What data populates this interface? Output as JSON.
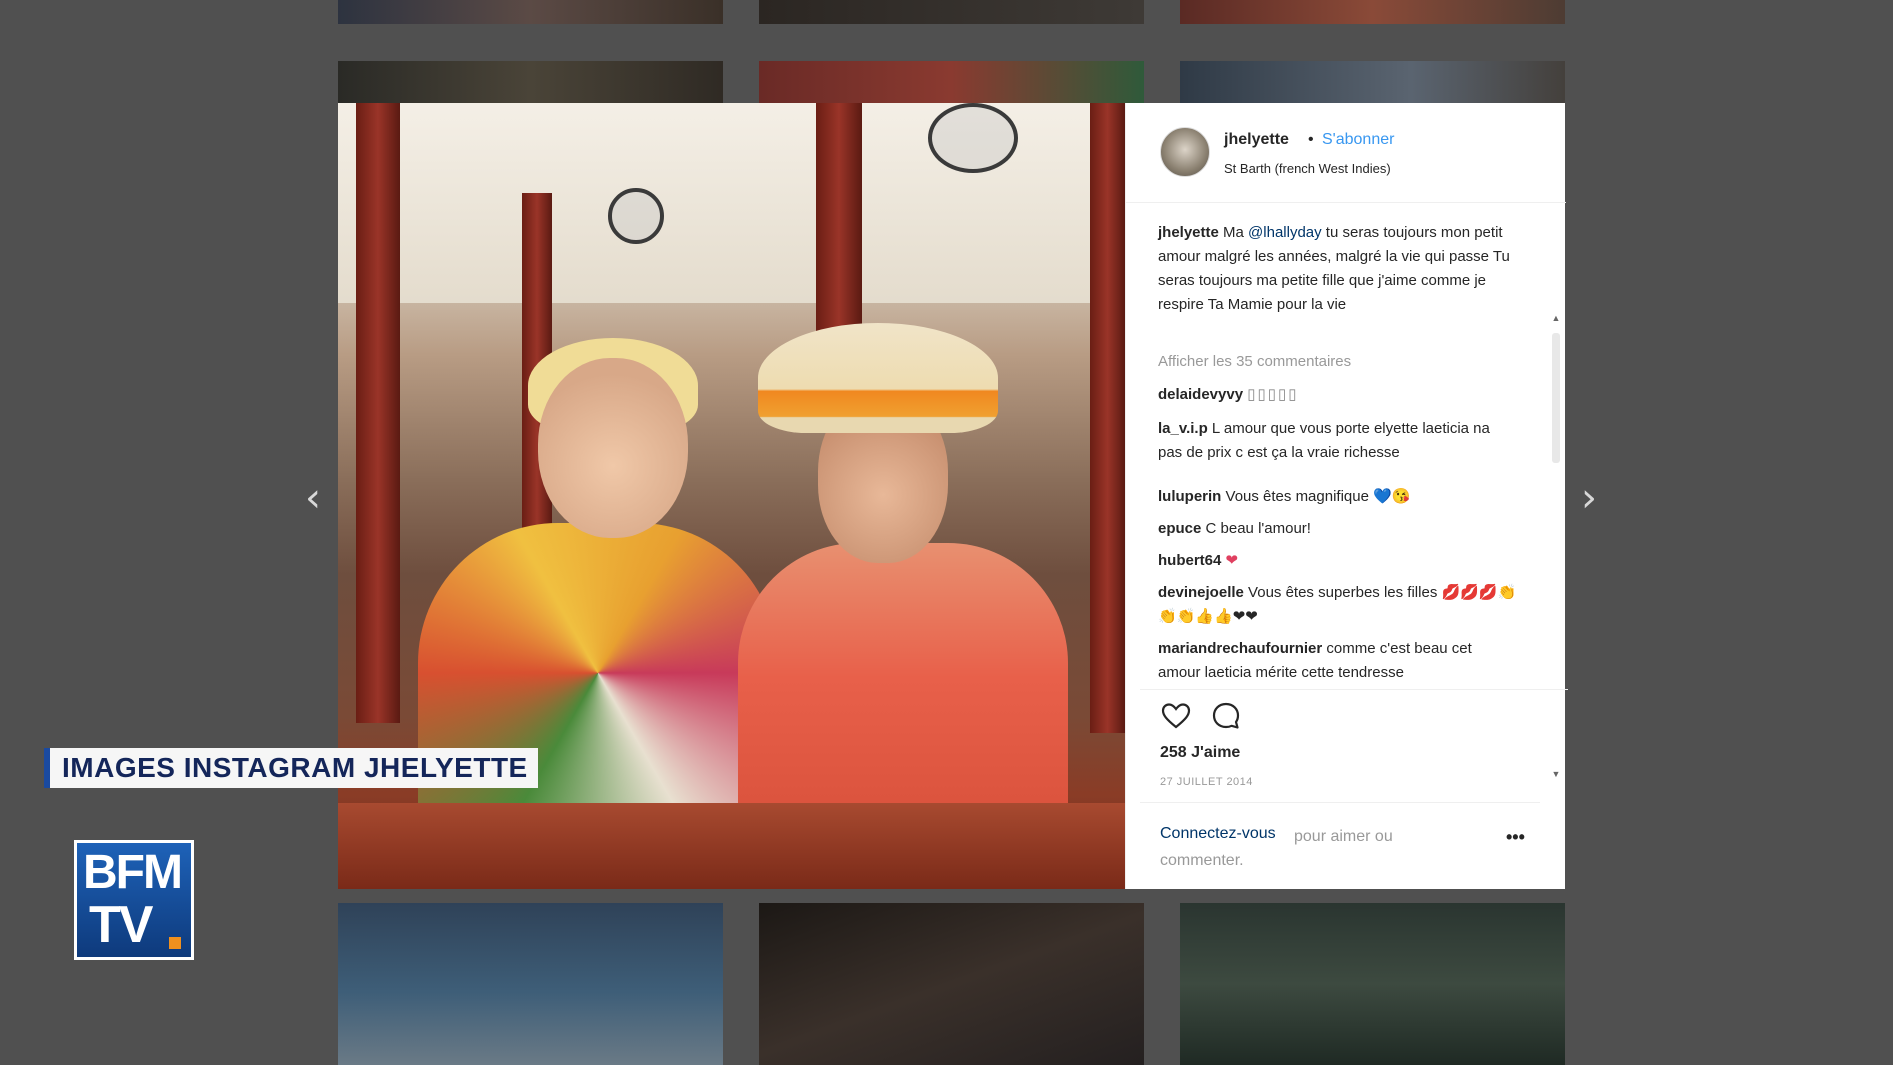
{
  "post": {
    "username": "jhelyette",
    "separator": "•",
    "follow_label": "S'abonner",
    "location": "St Barth (french West Indies)",
    "caption": {
      "user": "jhelyette",
      "text_before": "Ma ",
      "mention": "@lhallyday",
      "text_after": " tu seras toujours mon petit amour malgré les années, malgré la vie qui passe Tu seras toujours ma petite fille que j'aime comme je respire Ta Mamie pour la vie"
    },
    "view_all_comments": "Afficher les 35 commentaires",
    "comments": [
      {
        "user": "delaidevyvy",
        "text": "▯▯▯▯▯"
      },
      {
        "user": "la_v.i.p",
        "text": "L amour que vous porte elyette laeticia na pas de prix c est ça la vraie richesse"
      },
      {
        "user": "luluperin",
        "text": "Vous êtes magnifique 💙😘"
      },
      {
        "user": "epuce",
        "text": "C beau l'amour!"
      },
      {
        "user": "hubert64",
        "text": "❤"
      },
      {
        "user": "devinejoelle",
        "text": "Vous êtes superbes les filles 💋💋💋👏👏👏👍👍❤❤"
      },
      {
        "user": "mariandrechaufournier",
        "text": "comme c'est beau cet amour laeticia mérite cette tendresse"
      }
    ],
    "likes": "258 J'aime",
    "date": "27 JUILLET 2014",
    "login_link": "Connectez-vous",
    "login_rest": "pour aimer ou commenter.",
    "more_label": "•••"
  },
  "overlay": {
    "lower_third": "IMAGES INSTAGRAM JHELYETTE",
    "logo_line1": "BFM",
    "logo_line2": "TV"
  },
  "nav": {
    "prev_icon": "chevron-left-icon",
    "next_icon": "chevron-right-icon",
    "prev_glyph": "‹",
    "next_glyph": "›"
  },
  "colors": {
    "link_blue": "#3897f0",
    "mention_blue": "#003569",
    "bfm_blue": "#1e62b8",
    "bfm_orange": "#f0901e"
  }
}
